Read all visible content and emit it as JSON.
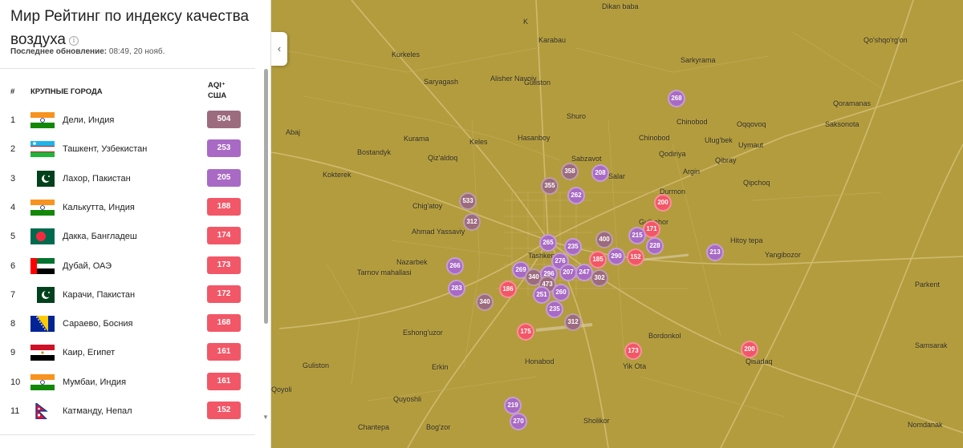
{
  "header": {
    "title": "Мир Рейтинг по индексу качества воздуха",
    "info_icon": "i",
    "updated_label": "Последнее обновление:",
    "updated_value": "08:49, 20 нояб."
  },
  "table": {
    "col_rank": "#",
    "col_city": "КРУПНЫЕ ГОРОДА",
    "col_aqi_line1": "AQI⁺",
    "col_aqi_line2": "США",
    "rows": [
      {
        "rank": "1",
        "flag": "india",
        "city": "Дели, Индия",
        "aqi": "504",
        "color": "#9c6b7e"
      },
      {
        "rank": "2",
        "flag": "uzbekistan",
        "city": "Ташкент, Узбекистан",
        "aqi": "253",
        "color": "#a86ac4"
      },
      {
        "rank": "3",
        "flag": "pakistan",
        "city": "Лахор, Пакистан",
        "aqi": "205",
        "color": "#a86ac4"
      },
      {
        "rank": "4",
        "flag": "india",
        "city": "Калькутта, Индия",
        "aqi": "188",
        "color": "#f25767"
      },
      {
        "rank": "5",
        "flag": "bangladesh",
        "city": "Дакка, Бангладеш",
        "aqi": "174",
        "color": "#f25767"
      },
      {
        "rank": "6",
        "flag": "uae",
        "city": "Дубай, ОАЭ",
        "aqi": "173",
        "color": "#f25767"
      },
      {
        "rank": "7",
        "flag": "pakistan",
        "city": "Карачи, Пакистан",
        "aqi": "172",
        "color": "#f25767"
      },
      {
        "rank": "8",
        "flag": "bosnia",
        "city": "Сараево, Босния",
        "aqi": "168",
        "color": "#f25767"
      },
      {
        "rank": "9",
        "flag": "egypt",
        "city": "Каир, Египет",
        "aqi": "161",
        "color": "#f25767"
      },
      {
        "rank": "10",
        "flag": "india",
        "city": "Мумбаи, Индия",
        "aqi": "161",
        "color": "#f25767"
      },
      {
        "rank": "11",
        "flag": "nepal",
        "city": "Катманду, Непал",
        "aqi": "152",
        "color": "#f25767"
      }
    ]
  },
  "map": {
    "collapse_icon": "‹",
    "places": [
      "Dikan baba",
      "K",
      "Karabau",
      "Qo'shqo'rg'on",
      "Kurkeles",
      "Sarkyrama",
      "Saryagash",
      "Alisher Navoiy",
      "Guliston",
      "Qoramanas",
      "Shuro",
      "Chinobod",
      "Abaj",
      "Oqqovoq",
      "Saksonota",
      "Kurama",
      "Keles",
      "Hasanboy",
      "Chinobod",
      "Ulug'bek",
      "Uymaut",
      "Bostandyk",
      "Qiz'aldoq",
      "Sabzavot",
      "Qodiriya",
      "Qibray",
      "Salar",
      "Kokterek",
      "Argin",
      "Qipchoq",
      "Durmon",
      "Chig'atoy",
      "Ahmad Yassaviy",
      "Gulbahor",
      "Hitoy tepa",
      "Yangibozor",
      "Nazarbek",
      "Tashkent",
      "Tarnov mahallasi",
      "Parkent",
      "Eshong'uzor",
      "Bordonkol",
      "Samsarak",
      "Guliston",
      "Erkin",
      "Honabod",
      "Yik Ota",
      "Qisadaq",
      "Qoyoli",
      "Quyoshli",
      "Chantepa",
      "Bog'zor",
      "Sholikor",
      "Nomdanak"
    ],
    "markers": [
      {
        "aqi": "268",
        "color": "#a86ac4"
      },
      {
        "aqi": "358",
        "color": "#9c6b7e"
      },
      {
        "aqi": "208",
        "color": "#a86ac4"
      },
      {
        "aqi": "355",
        "color": "#9c6b7e"
      },
      {
        "aqi": "262",
        "color": "#a86ac4"
      },
      {
        "aqi": "200",
        "color": "#f25767"
      },
      {
        "aqi": "533",
        "color": "#9c6b7e"
      },
      {
        "aqi": "312",
        "color": "#9c6b7e"
      },
      {
        "aqi": "171",
        "color": "#f25767"
      },
      {
        "aqi": "215",
        "color": "#a86ac4"
      },
      {
        "aqi": "228",
        "color": "#a86ac4"
      },
      {
        "aqi": "400",
        "color": "#9c6b7e"
      },
      {
        "aqi": "265",
        "color": "#a86ac4"
      },
      {
        "aqi": "235",
        "color": "#a86ac4"
      },
      {
        "aqi": "276",
        "color": "#a86ac4"
      },
      {
        "aqi": "185",
        "color": "#f25767"
      },
      {
        "aqi": "290",
        "color": "#a86ac4"
      },
      {
        "aqi": "152",
        "color": "#f25767"
      },
      {
        "aqi": "213",
        "color": "#a86ac4"
      },
      {
        "aqi": "266",
        "color": "#a86ac4"
      },
      {
        "aqi": "269",
        "color": "#a86ac4"
      },
      {
        "aqi": "340",
        "color": "#9c6b7e"
      },
      {
        "aqi": "296",
        "color": "#a86ac4"
      },
      {
        "aqi": "207",
        "color": "#a86ac4"
      },
      {
        "aqi": "247",
        "color": "#a86ac4"
      },
      {
        "aqi": "302",
        "color": "#9c6b7e"
      },
      {
        "aqi": "283",
        "color": "#a86ac4"
      },
      {
        "aqi": "186",
        "color": "#f25767"
      },
      {
        "aqi": "473",
        "color": "#9c6b7e"
      },
      {
        "aqi": "251",
        "color": "#a86ac4"
      },
      {
        "aqi": "260",
        "color": "#a86ac4"
      },
      {
        "aqi": "340",
        "color": "#9c6b7e"
      },
      {
        "aqi": "235",
        "color": "#a86ac4"
      },
      {
        "aqi": "175",
        "color": "#f25767"
      },
      {
        "aqi": "312",
        "color": "#9c6b7e"
      },
      {
        "aqi": "173",
        "color": "#f25767"
      },
      {
        "aqi": "200",
        "color": "#f25767"
      },
      {
        "aqi": "219",
        "color": "#a86ac4"
      },
      {
        "aqi": "270",
        "color": "#a86ac4"
      }
    ]
  }
}
